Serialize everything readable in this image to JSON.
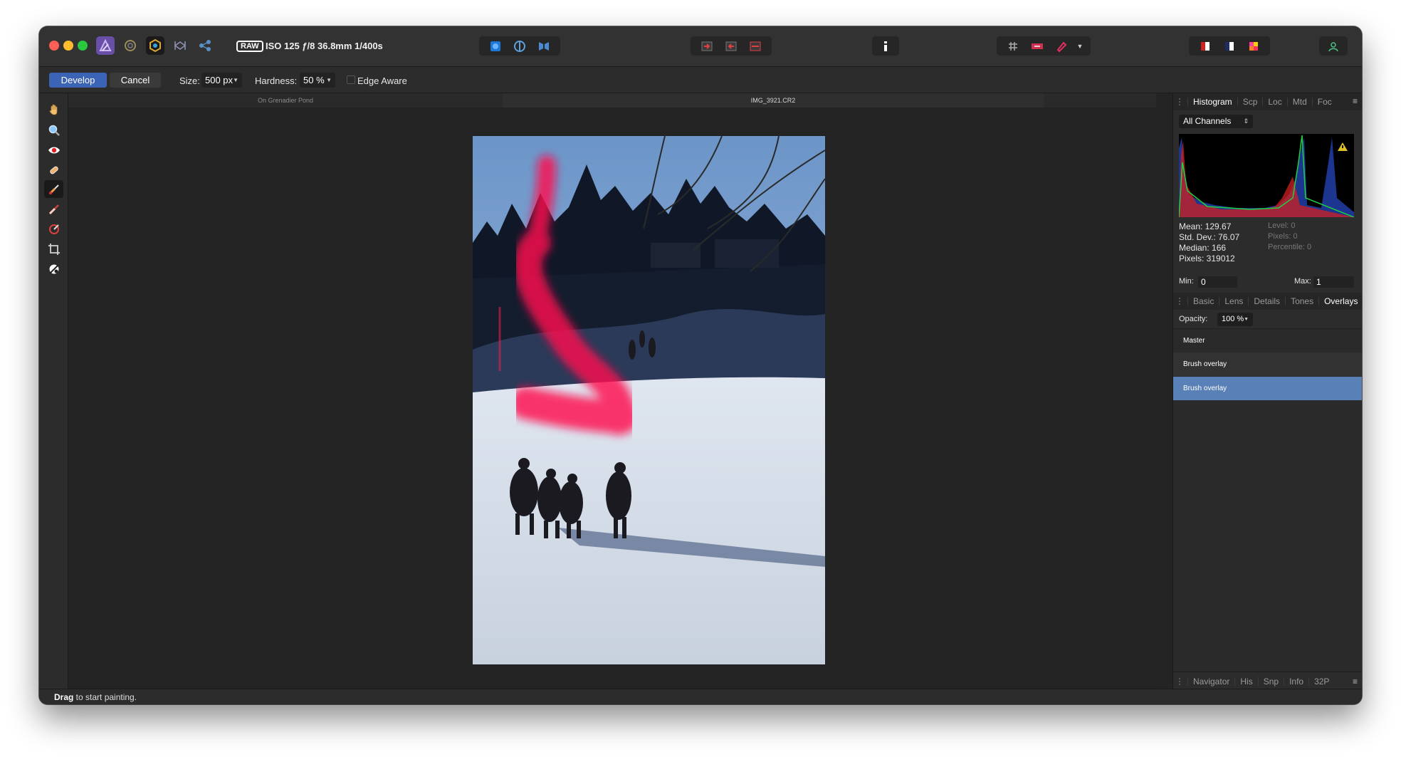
{
  "toolbar": {
    "exif_badge": "RAW",
    "exif_text": "ISO 125 ƒ/8 36.8mm 1/400s"
  },
  "context": {
    "develop_label": "Develop",
    "cancel_label": "Cancel",
    "size_label": "Size:",
    "size_value": "500 px",
    "hardness_label": "Hardness:",
    "hardness_value": "50 %",
    "edge_aware_label": "Edge Aware"
  },
  "tabs": {
    "doc1": "On Grenadier Pond",
    "doc2": "IMG_3921.CR2"
  },
  "studio": {
    "top_tabs": [
      "Histogram",
      "Scp",
      "Loc",
      "Mtd",
      "Foc"
    ],
    "channel_select": "All Channels",
    "stats": {
      "mean": "Mean: 129.67",
      "std_dev": "Std. Dev.: 76.07",
      "median": "Median: 166",
      "pixels": "Pixels: 319012",
      "level": "Level: 0",
      "pixels_right": "Pixels: 0",
      "percentile": "Percentile: 0"
    },
    "min_label": "Min:",
    "min_value": "0",
    "max_label": "Max:",
    "max_value": "1",
    "mid_tabs": [
      "Basic",
      "Lens",
      "Details",
      "Tones",
      "Overlays"
    ],
    "opacity_label": "Opacity:",
    "opacity_value": "100 %",
    "overlays": [
      "Master",
      "Brush overlay",
      "Brush overlay"
    ],
    "bottom_tabs": [
      "Navigator",
      "His",
      "Snp",
      "Info",
      "32P"
    ]
  },
  "status": {
    "bold": "Drag",
    "rest": " to start painting."
  },
  "colors": {
    "accent": "#3c64b6",
    "selected_row": "#5a80b8",
    "overlay_mask": "#ff1050"
  }
}
